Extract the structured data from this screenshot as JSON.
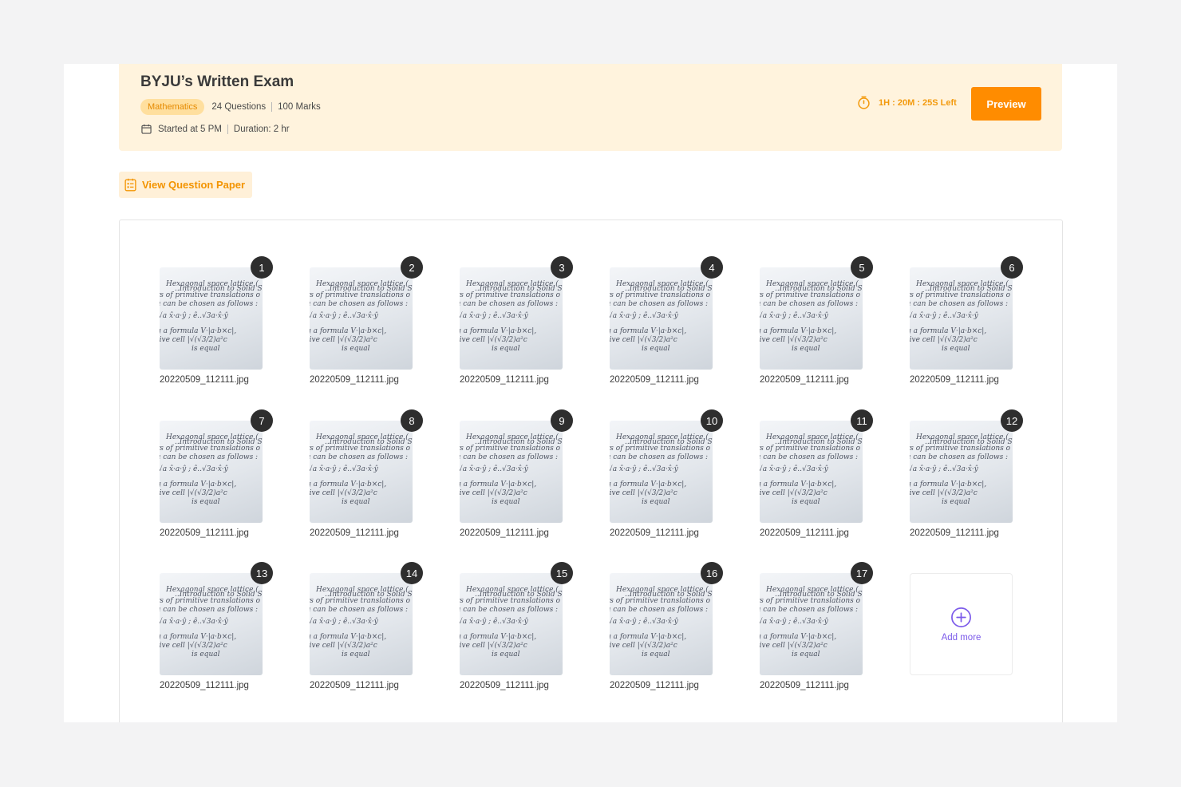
{
  "exam": {
    "title": "BYJU’s Written Exam",
    "subject": "Mathematics",
    "questions": "24 Questions",
    "marks": "100 Marks",
    "started": "Started at 5 PM",
    "duration": "Duration: 2 hr",
    "time_left": "1H : 20M : 25S Left",
    "preview_label": "Preview"
  },
  "view_question_paper_label": "View Question Paper",
  "uploads": [
    {
      "num": "1",
      "file": "20220509_112111.jpg"
    },
    {
      "num": "2",
      "file": "20220509_112111.jpg"
    },
    {
      "num": "3",
      "file": "20220509_112111.jpg"
    },
    {
      "num": "4",
      "file": "20220509_112111.jpg"
    },
    {
      "num": "5",
      "file": "20220509_112111.jpg"
    },
    {
      "num": "6",
      "file": "20220509_112111.jpg"
    },
    {
      "num": "7",
      "file": "20220509_112111.jpg"
    },
    {
      "num": "8",
      "file": "20220509_112111.jpg"
    },
    {
      "num": "9",
      "file": "20220509_112111.jpg"
    },
    {
      "num": "10",
      "file": "20220509_112111.jpg"
    },
    {
      "num": "11",
      "file": "20220509_112111.jpg"
    },
    {
      "num": "12",
      "file": "20220509_112111.jpg"
    },
    {
      "num": "13",
      "file": "20220509_112111.jpg"
    },
    {
      "num": "14",
      "file": "20220509_112111.jpg"
    },
    {
      "num": "15",
      "file": "20220509_112111.jpg"
    },
    {
      "num": "16",
      "file": "20220509_112111.jpg"
    },
    {
      "num": "17",
      "file": "20220509_112111.jpg"
    }
  ],
  "add_more_label": "Add more",
  "colors": {
    "accent": "#ff8c00",
    "header_bg": "#fff3dd",
    "add_more": "#7c5bea"
  }
}
